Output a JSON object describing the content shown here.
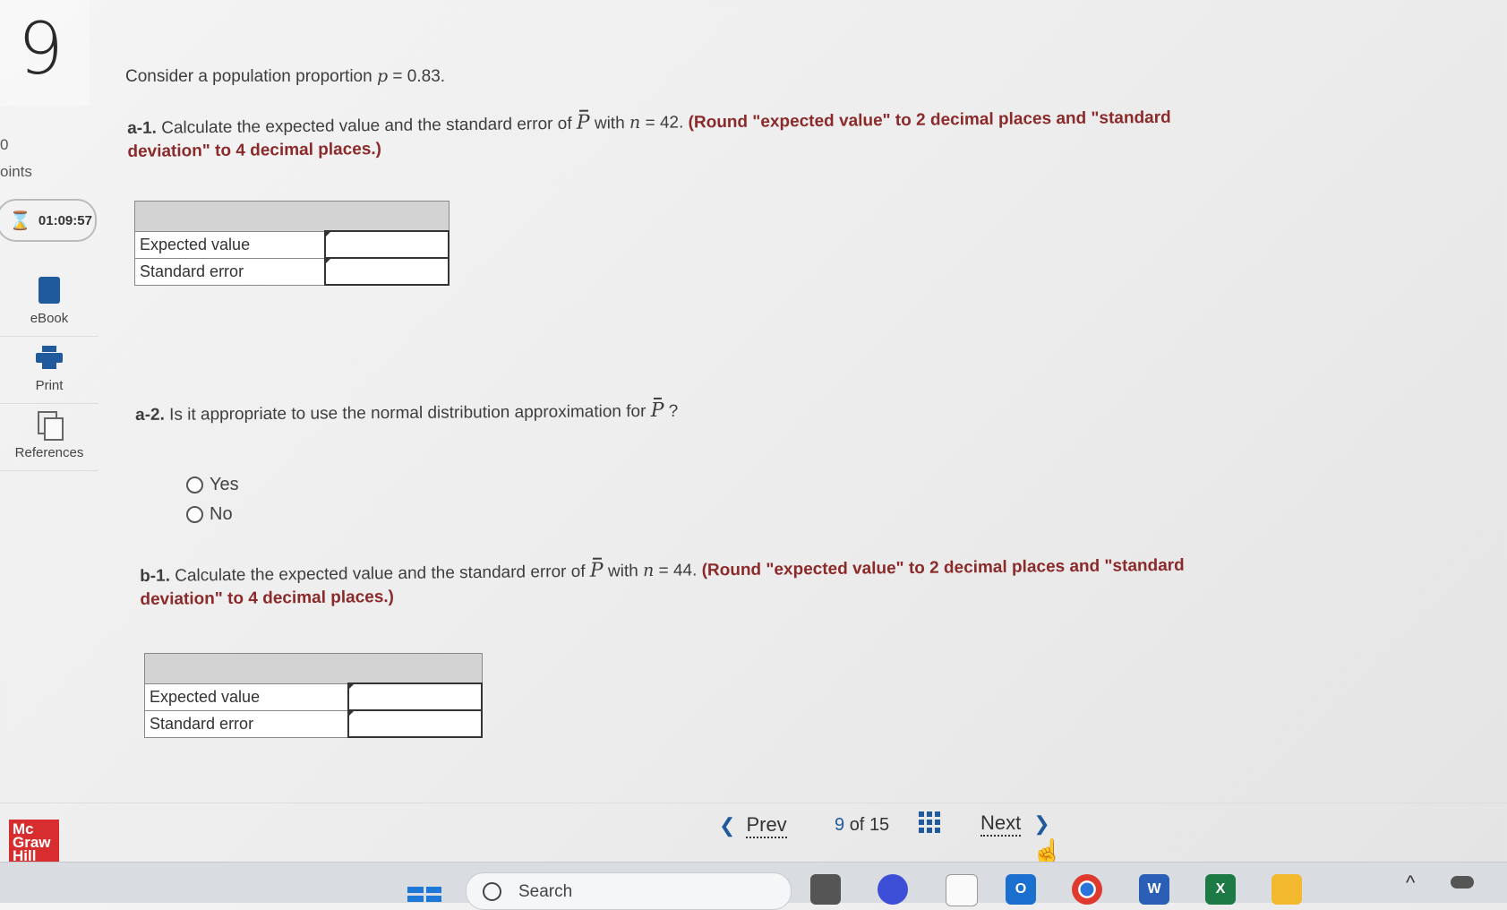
{
  "question_number": "9",
  "points": {
    "value": "0",
    "label": "oints"
  },
  "timer": "01:09:57",
  "tools": [
    {
      "label": "eBook",
      "icon": "book-icon"
    },
    {
      "label": "Print",
      "icon": "printer-icon"
    },
    {
      "label": "References",
      "icon": "references-icon"
    }
  ],
  "intro": {
    "text": "Consider a population proportion ",
    "var": "p",
    "eq": " = 0.83."
  },
  "a1": {
    "tag": "a-1.",
    "text": " Calculate the expected value and the standard error of ",
    "var": "P",
    "with": " with ",
    "n": "n",
    "n_eq": " = 42.",
    "instruction": "(Round \"expected value\" to 2 decimal places and \"standard deviation\" to 4 decimal places.)"
  },
  "a1_table": {
    "rows": [
      {
        "label": "Expected value",
        "value": ""
      },
      {
        "label": "Standard error",
        "value": ""
      }
    ]
  },
  "a2": {
    "tag": "a-2.",
    "text": " Is it appropriate to use the normal distribution approximation for ",
    "var": "P",
    "q": " ?",
    "options": [
      "Yes",
      "No"
    ]
  },
  "b1": {
    "tag": "b-1.",
    "text": " Calculate the expected value and the standard error of ",
    "var": "P",
    "with": " with ",
    "n": "n",
    "n_eq": " = 44.",
    "instruction": "(Round \"expected value\" to 2 decimal places and \"standard deviation\" to 4 decimal places.)"
  },
  "b1_table": {
    "rows": [
      {
        "label": "Expected value",
        "value": ""
      },
      {
        "label": "Standard error",
        "value": ""
      }
    ]
  },
  "nav": {
    "prev": "Prev",
    "current": "9",
    "of": "of",
    "total": "15",
    "next": "Next"
  },
  "logo": {
    "line1": "Mc",
    "line2": "Graw",
    "line3": "Hill"
  },
  "taskbar": {
    "search_placeholder": "Search",
    "outlook_letter": "O",
    "word_letter": "W",
    "excel_letter": "X"
  }
}
